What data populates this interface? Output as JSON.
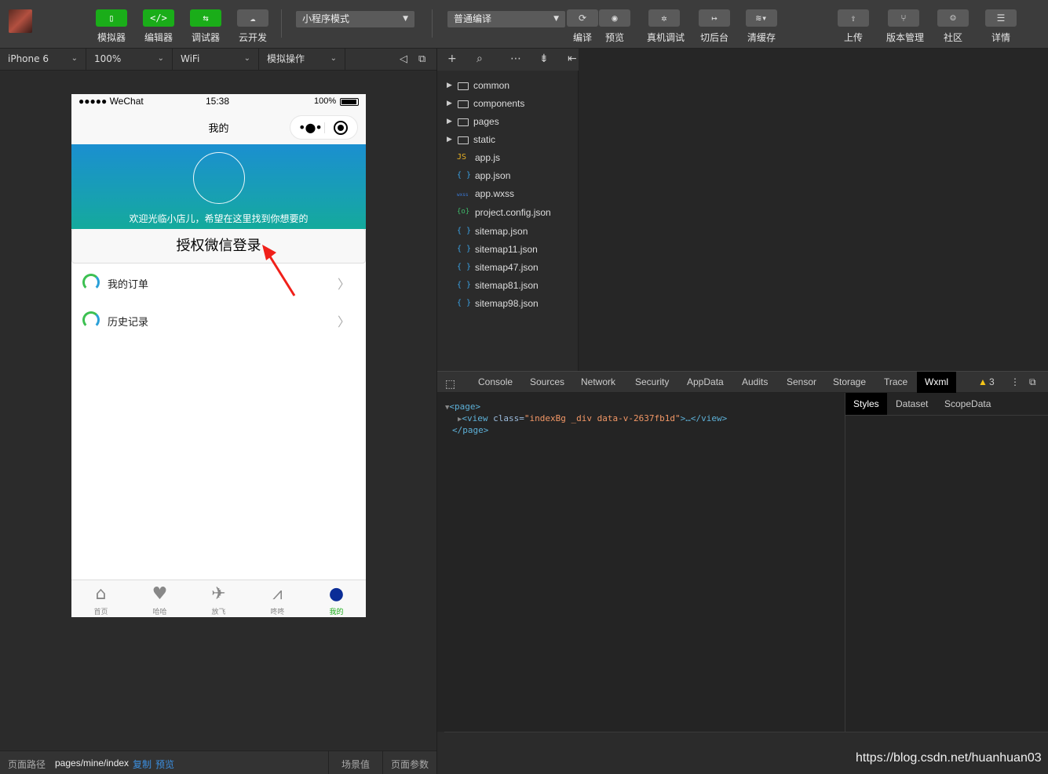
{
  "toolbar": {
    "simulator": "模拟器",
    "editor": "编辑器",
    "debugger": "调试器",
    "cloud": "云开发",
    "mode_select": "小程序模式",
    "compile_select": "普通编译",
    "compile": "编译",
    "preview": "预览",
    "real_debug": "真机调试",
    "backstage": "切后台",
    "clear_cache": "清缓存",
    "upload": "上传",
    "version": "版本管理",
    "community": "社区",
    "details": "详情"
  },
  "subbar": {
    "device": "iPhone 6",
    "zoom": "100%",
    "network": "WiFi",
    "operation": "模拟操作"
  },
  "phone": {
    "carrier": "●●●●● WeChat",
    "time": "15:38",
    "battery": "100%",
    "nav_title": "我的",
    "welcome": "欢迎光临小店儿，希望在这里找到你想要的",
    "login_button": "授权微信登录",
    "menu": [
      {
        "label": "我的订单"
      },
      {
        "label": "历史记录"
      }
    ],
    "tabs": [
      {
        "label": "首页",
        "icon": "home-icon"
      },
      {
        "label": "哈哈",
        "icon": "broken-heart-icon"
      },
      {
        "label": "放飞",
        "icon": "rocket-icon"
      },
      {
        "label": "咚咚",
        "icon": "chart-icon"
      },
      {
        "label": "我的",
        "icon": "user-icon"
      }
    ],
    "active_tab_color": "#1aad19",
    "active_icon_color": "#0b2d97"
  },
  "filetree": {
    "folders": [
      "common",
      "components",
      "pages",
      "static"
    ],
    "files": [
      {
        "type": "JS",
        "name": "app.js"
      },
      {
        "type": "{ }",
        "name": "app.json"
      },
      {
        "type": "wxss",
        "name": "app.wxss"
      },
      {
        "type": "{o}",
        "name": "project.config.json"
      },
      {
        "type": "{ }",
        "name": "sitemap.json"
      },
      {
        "type": "{ }",
        "name": "sitemap11.json"
      },
      {
        "type": "{ }",
        "name": "sitemap47.json"
      },
      {
        "type": "{ }",
        "name": "sitemap81.json"
      },
      {
        "type": "{ }",
        "name": "sitemap98.json"
      }
    ]
  },
  "devtools": {
    "tabs": [
      "Console",
      "Sources",
      "Network",
      "Security",
      "AppData",
      "Audits",
      "Sensor",
      "Storage",
      "Trace",
      "Wxml"
    ],
    "active_tab": "Wxml",
    "warnings": "3",
    "wxml": {
      "page_open": "<page>",
      "view_tag_open": "<view",
      "class_attr": "class=",
      "class_value": "\"indexBg _div data-v-2637fb1d\"",
      "view_close": ">…</view>",
      "page_close": "</page>"
    },
    "side_tabs": [
      "Styles",
      "Dataset",
      "ScopeData"
    ]
  },
  "statusbar": {
    "path_label": "页面路径",
    "path": "pages/mine/index",
    "copy": "复制",
    "preview": "预览",
    "scene": "场景值",
    "params": "页面参数"
  },
  "watermark": "https://blog.csdn.net/huanhuan03"
}
